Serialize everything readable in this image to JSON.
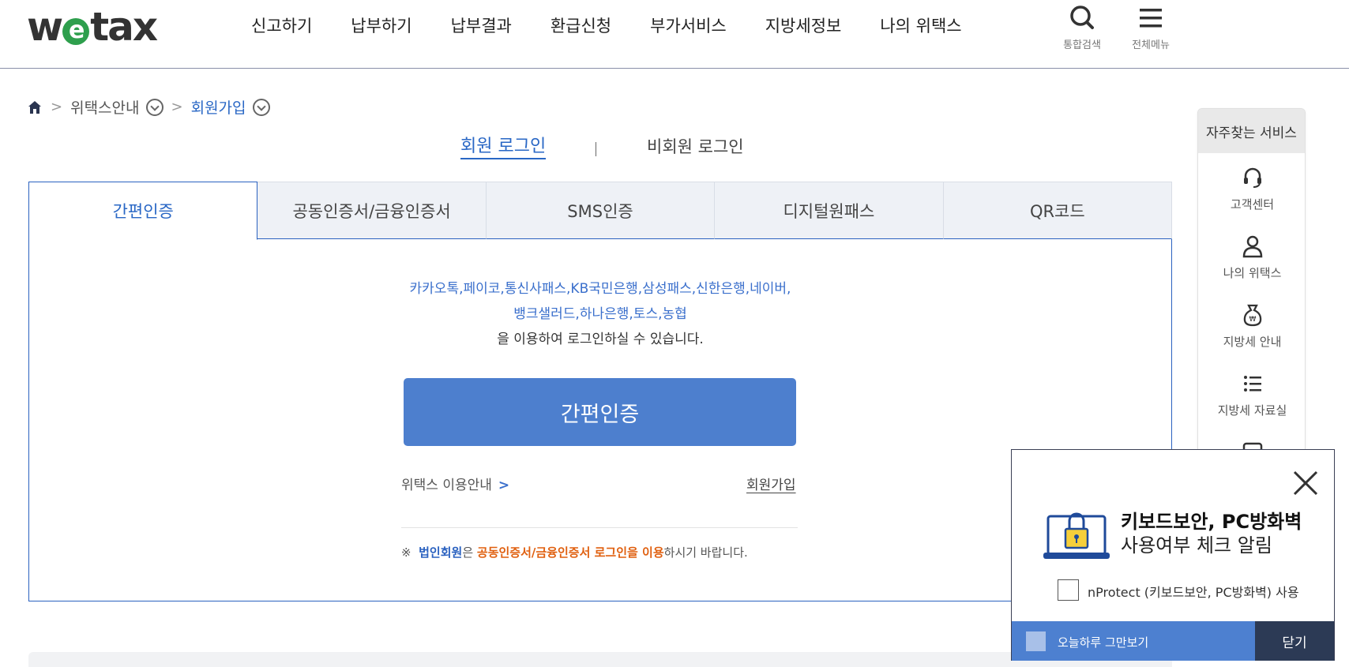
{
  "header": {
    "logo": {
      "pre": "w",
      "e": "e",
      "post": "tax"
    },
    "nav": [
      "신고하기",
      "납부하기",
      "납부결과",
      "환급신청",
      "부가서비스",
      "지방세정보",
      "나의 위택스"
    ],
    "search_label": "통합검색",
    "menu_label": "전체메뉴"
  },
  "breadcrumb": {
    "level1": "위택스안내",
    "level2": "회원가입"
  },
  "login_type": {
    "member": "회원 로그인",
    "guest": "비회원 로그인"
  },
  "tabs": [
    "간편인증",
    "공동인증서/금융인증서",
    "SMS인증",
    "디지털원패스",
    "QR코드"
  ],
  "active_tab": "간편인증",
  "simple_auth": {
    "providers_line1": "카카오톡,페이코,통신사패스,KB국민은행,삼성패스,신한은행,네이버,",
    "providers_line2": "뱅크샐러드,하나은행,토스,농협",
    "desc": "을 이용하여 로그인하실 수 있습니다.",
    "button": "간편인증",
    "guide_link": "위택스 이용안내",
    "join_link": "회원가입",
    "note_mark": "※",
    "note_corp": "법인회원",
    "note_mid": "은 ",
    "note_highlight": "공동인증서/금융인증서 로그인을 이용",
    "note_end": "하시기 바랍니다."
  },
  "quick_menu": {
    "title": "자주찾는 서비스",
    "items": [
      "고객센터",
      "나의 위택스",
      "지방세 안내",
      "지방세 자료실"
    ]
  },
  "popup": {
    "title": "키보드보안, PC방화벽",
    "subtitle": "사용여부 체크 알림",
    "checkbox_label": "nProtect (키보드보안, PC방화벽) 사용",
    "today_label": "오늘하루 그만보기",
    "close_label": "닫기"
  }
}
